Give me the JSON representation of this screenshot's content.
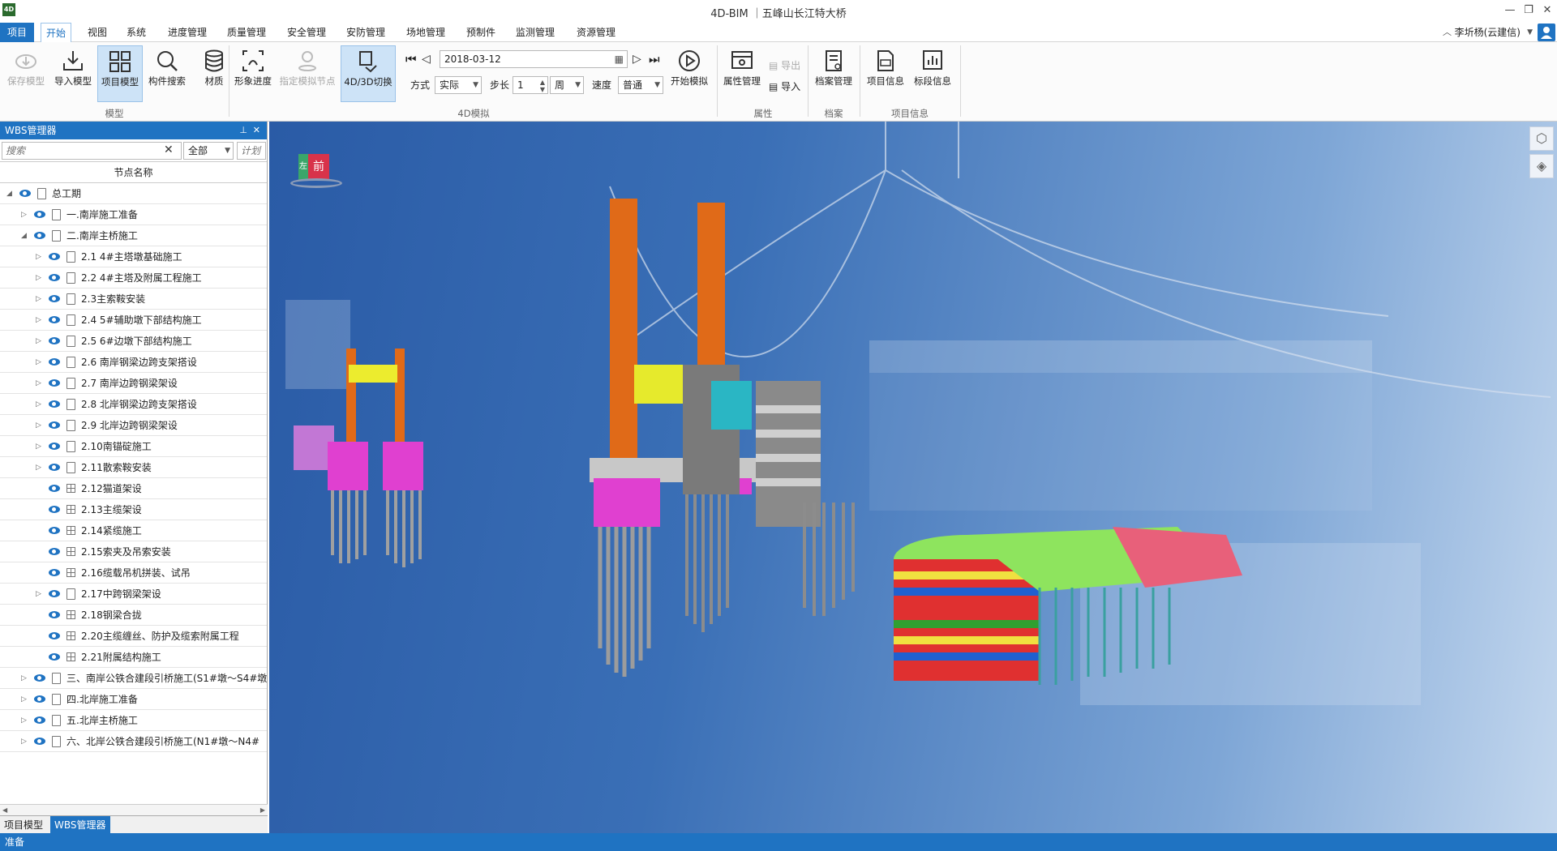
{
  "window": {
    "title": "4D-BIM ｜五峰山长江特大桥",
    "logo": "4D"
  },
  "menu": {
    "items": [
      "项目",
      "开始",
      "视图",
      "系统",
      "进度管理",
      "质量管理",
      "安全管理",
      "安防管理",
      "场地管理",
      "预制件",
      "监测管理",
      "资源管理"
    ],
    "active": "开始",
    "user": "李圻杨(云建信)"
  },
  "ribbon": {
    "model_group": {
      "label": "模型",
      "buttons": [
        "保存模型",
        "导入模型",
        "项目模型",
        "构件搜索",
        "材质"
      ]
    },
    "sim_group": {
      "label": "4D模拟",
      "buttons": [
        "形象进度",
        "指定模拟节点",
        "4D/3D切换"
      ],
      "date": "2018-03-12",
      "mode_label": "方式",
      "mode_value": "实际",
      "step_label": "步长",
      "step_value": "1",
      "unit_value": "周",
      "speed_label": "速度",
      "speed_value": "普通",
      "start_label": "开始模拟"
    },
    "attr_group": {
      "label": "属性",
      "manage": "属性管理",
      "export": "导出",
      "import": "导入"
    },
    "archive_group": {
      "label": "档案",
      "manage": "档案管理"
    },
    "project_group": {
      "label": "项目信息",
      "buttons": [
        "项目信息",
        "标段信息"
      ]
    }
  },
  "panel": {
    "title": "WBS管理器",
    "search_placeholder": "搜索",
    "filter_value": "全部",
    "plan_placeholder": "计划",
    "column_header": "节点名称",
    "rows": [
      {
        "label": "总工期",
        "level": 0,
        "expand": "open",
        "icon": "doc"
      },
      {
        "label": "一.南岸施工准备",
        "level": 1,
        "expand": "closed",
        "icon": "doc"
      },
      {
        "label": "二.南岸主桥施工",
        "level": 1,
        "expand": "open",
        "icon": "doc"
      },
      {
        "label": "2.1 4#主塔墩基础施工",
        "level": 2,
        "expand": "closed",
        "icon": "doc"
      },
      {
        "label": "2.2 4#主塔及附属工程施工",
        "level": 2,
        "expand": "closed",
        "icon": "doc"
      },
      {
        "label": "2.3主索鞍安装",
        "level": 2,
        "expand": "closed",
        "icon": "doc"
      },
      {
        "label": "2.4 5#辅助墩下部结构施工",
        "level": 2,
        "expand": "closed",
        "icon": "doc"
      },
      {
        "label": "2.5 6#边墩下部结构施工",
        "level": 2,
        "expand": "closed",
        "icon": "doc"
      },
      {
        "label": "2.6 南岸钢梁边跨支架搭设",
        "level": 2,
        "expand": "closed",
        "icon": "doc"
      },
      {
        "label": "2.7 南岸边跨钢梁架设",
        "level": 2,
        "expand": "closed",
        "icon": "doc"
      },
      {
        "label": "2.8 北岸钢梁边跨支架搭设",
        "level": 2,
        "expand": "closed",
        "icon": "doc"
      },
      {
        "label": "2.9 北岸边跨钢梁架设",
        "level": 2,
        "expand": "closed",
        "icon": "doc"
      },
      {
        "label": "2.10南锚碇施工",
        "level": 2,
        "expand": "closed",
        "icon": "doc"
      },
      {
        "label": "2.11散索鞍安装",
        "level": 2,
        "expand": "closed",
        "icon": "doc"
      },
      {
        "label": "2.12猫道架设",
        "level": 2,
        "expand": "none",
        "icon": "grid"
      },
      {
        "label": "2.13主缆架设",
        "level": 2,
        "expand": "none",
        "icon": "grid"
      },
      {
        "label": "2.14紧缆施工",
        "level": 2,
        "expand": "none",
        "icon": "grid"
      },
      {
        "label": "2.15索夹及吊索安装",
        "level": 2,
        "expand": "none",
        "icon": "grid"
      },
      {
        "label": "2.16缆载吊机拼装、试吊",
        "level": 2,
        "expand": "none",
        "icon": "grid"
      },
      {
        "label": "2.17中跨钢梁架设",
        "level": 2,
        "expand": "closed",
        "icon": "doc"
      },
      {
        "label": "2.18钢梁合拢",
        "level": 2,
        "expand": "none",
        "icon": "grid"
      },
      {
        "label": "2.20主缆缠丝、防护及缆索附属工程",
        "level": 2,
        "expand": "none",
        "icon": "grid"
      },
      {
        "label": "2.21附属结构施工",
        "level": 2,
        "expand": "none",
        "icon": "grid"
      },
      {
        "label": "三、南岸公铁合建段引桥施工(S1#墩～S4#墩",
        "level": 1,
        "expand": "closed",
        "icon": "doc"
      },
      {
        "label": "四.北岸施工准备",
        "level": 1,
        "expand": "closed",
        "icon": "doc"
      },
      {
        "label": "五.北岸主桥施工",
        "level": 1,
        "expand": "closed",
        "icon": "doc"
      },
      {
        "label": "六、北岸公铁合建段引桥施工(N1#墩～N4#",
        "level": 1,
        "expand": "closed",
        "icon": "doc"
      }
    ],
    "tabs": [
      "项目模型",
      "WBS管理器"
    ],
    "active_tab": "WBS管理器"
  },
  "viewcube": {
    "front_label": "前",
    "left_label": "左"
  },
  "status": {
    "text": "准备"
  }
}
